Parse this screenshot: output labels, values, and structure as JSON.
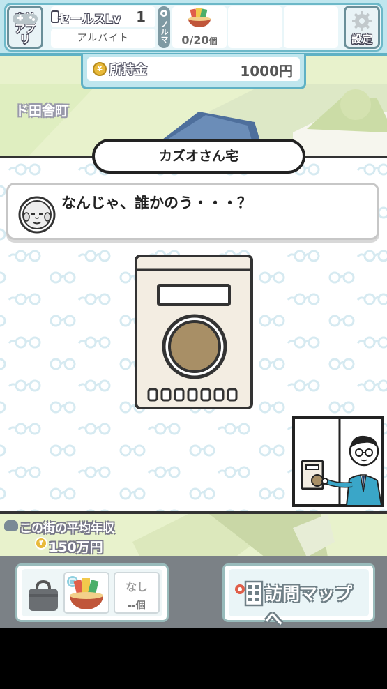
{
  "hud": {
    "app_button_label": "自社アプリ",
    "settings_label": "設定",
    "sales_level_label": "セールスLv",
    "sales_level_value": "1",
    "job_title": "アルバイト",
    "norma_label": "ノルマ",
    "norma_count": "0/20",
    "norma_unit": "個"
  },
  "money": {
    "label": "所持金",
    "value": "1000円",
    "coin_symbol": "¥"
  },
  "town": {
    "name": "ド田舎町"
  },
  "scene": {
    "place_name": "カズオさん宅",
    "speech": "なんじゃ、誰かのう・・・？",
    "speaker_icon": "old-man-face-icon"
  },
  "income": {
    "label": "この街の平均年収",
    "value": "150万円",
    "coin_symbol": "¥"
  },
  "inventory": {
    "none_label": "なし",
    "count_label": "--個"
  },
  "map_button": {
    "label": "訪問マップへ"
  },
  "colors": {
    "hud_blue": "#bfe6ee",
    "hud_border": "#5fb1c4",
    "ground": "#e8f2cc",
    "pattern": "#d8ecf2",
    "intercom_body": "#f3ede2",
    "intercom_button": "#a88f66",
    "suit": "#3aa6c8"
  }
}
